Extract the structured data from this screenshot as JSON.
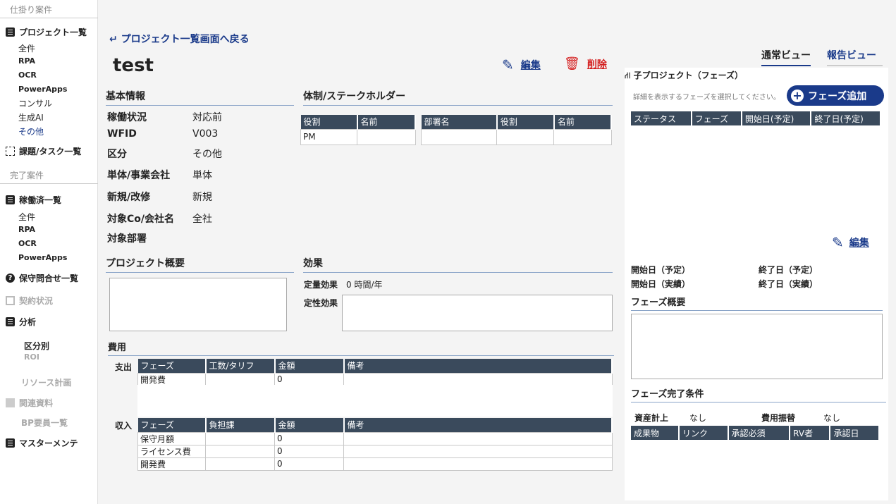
{
  "sidebar": {
    "section_open": "仕掛り案件",
    "project_list": "プロジェクト一覧",
    "project_sub": [
      "全件",
      "RPA",
      "OCR",
      "PowerApps",
      "コンサル",
      "生成AI",
      "その他"
    ],
    "tasks": "課題/タスク一覧",
    "section_done": "完了案件",
    "done_list": "稼働済一覧",
    "done_sub": [
      "全件",
      "RPA",
      "OCR",
      "PowerApps"
    ],
    "support": "保守問合せ一覧",
    "contract": "契約状況",
    "analysis": "分析",
    "analysis_sub": [
      "区分別",
      "ROI"
    ],
    "resource": "リソース計画",
    "related": "関連資料",
    "bp": "BP要員一覧",
    "master": "マスターメンテ"
  },
  "header": {
    "back": "プロジェクト一覧画面へ戻る",
    "title": "test",
    "edit": "編集",
    "delete": "削除"
  },
  "basic": {
    "heading": "基本情報",
    "rows": [
      {
        "label": "稼働状況",
        "value": "対応前"
      },
      {
        "label": "WFID",
        "value": "V003"
      },
      {
        "label": "区分",
        "value": "その他"
      },
      {
        "label": "単体/事業会社",
        "value": "単体"
      },
      {
        "label": "新規/改修",
        "value": "新規"
      },
      {
        "label": "対象Co/会社名",
        "value": "全社"
      },
      {
        "label": "対象部署",
        "value": ""
      }
    ]
  },
  "stake": {
    "heading": "体制/ステークホルダー",
    "t1_cols": [
      "役割",
      "名前"
    ],
    "t1_rows": [
      [
        "PM",
        ""
      ]
    ],
    "t2_cols": [
      "部署名",
      "役割",
      "名前"
    ],
    "t2_rows": [
      [
        "",
        "",
        ""
      ]
    ]
  },
  "overview": {
    "heading": "プロジェクト概要"
  },
  "effect": {
    "heading": "効果",
    "quant_label": "定量効果",
    "quant_value": "0 時間/年",
    "qual_label": "定性効果"
  },
  "cost": {
    "heading": "費用",
    "expense_label": "支出",
    "cols": [
      "フェーズ",
      "工数/タリフ",
      "金額",
      "備考"
    ],
    "expense_rows": [
      [
        "開発費",
        "",
        "0",
        ""
      ]
    ],
    "income_label": "収入",
    "income_cols": [
      "フェーズ",
      "負担課",
      "金額",
      "備考"
    ],
    "income_rows": [
      [
        "保守月額",
        "",
        "0",
        ""
      ],
      [
        "ライセンス費",
        "",
        "0",
        ""
      ],
      [
        "開発費",
        "",
        "0",
        ""
      ]
    ]
  },
  "views": {
    "normal": "通常ビュー",
    "report": "報告ビュー"
  },
  "child": {
    "heading": "子プロジェクト（フェーズ）",
    "hint": "詳細を表示するフェーズを選択してください。",
    "add": "フェーズ追加",
    "cols": [
      "ステータス",
      "フェーズ",
      "開始日(予定)",
      "終了日(予定)"
    ],
    "edit": "編集",
    "start_plan": "開始日（予定）",
    "end_plan": "終了日（予定）",
    "start_act": "開始日（実績）",
    "end_act": "終了日（実績）",
    "overview": "フェーズ概要",
    "complete": "フェーズ完了条件",
    "asset_label": "資産計上",
    "asset_value": "なし",
    "cost_label": "費用振替",
    "cost_value": "なし",
    "deliv_cols": [
      "成果物",
      "リンク",
      "承認必須",
      "RV者",
      "承認日"
    ]
  },
  "colors": {
    "accent": "#1a3a8a",
    "header": "#3a4a5c",
    "danger": "#d42020"
  }
}
